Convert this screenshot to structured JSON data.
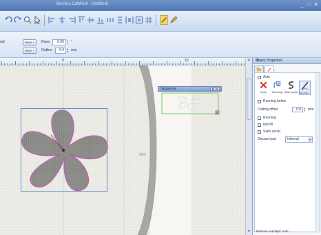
{
  "window": {
    "title": "Bernina CutWork - [Untitled]",
    "controls": [
      "_",
      "□",
      "✕"
    ]
  },
  "propbar": {
    "row1_label_cut": "nal",
    "more_label": "More »",
    "rows_label": "Rows",
    "rows_value": "0.00",
    "rows_unit": "°",
    "outline_label": "Outline",
    "outline_value": "0.4",
    "outline_unit": "mm"
  },
  "ruler": {
    "labels": [
      "0",
      "10"
    ]
  },
  "sequence": {
    "title": "Sequence"
  },
  "object_properties": {
    "title": "Object Properties",
    "close": "✕",
    "auto_label": "Auto",
    "cut_types": [
      {
        "label": "None",
        "icon": "none-x-icon"
      },
      {
        "label": "Running",
        "icon": "running-icon"
      },
      {
        "label": "Satin serial",
        "icon": "satin-serial-icon"
      },
      {
        "label": "Cut Wo...",
        "icon": "cutwork-icon"
      }
    ],
    "running_below": "Running below",
    "cutting_offset_label": "Cutting offset",
    "cutting_offset_value": "0.0",
    "cutting_offset_unit": "mm",
    "running": "Running",
    "net_fill": "Net fill",
    "satin_serial": "Satin serial",
    "discard_part_label": "Discard part",
    "discard_part_value": "Internal",
    "remove_overlaps": "Remove overlaps: Auto"
  },
  "colors": {
    "accent": "#5b8fd6",
    "flower_fill": "#8a8a86",
    "flower_outline": "#c04fb0",
    "sequence_outline": "#5fc35a"
  }
}
